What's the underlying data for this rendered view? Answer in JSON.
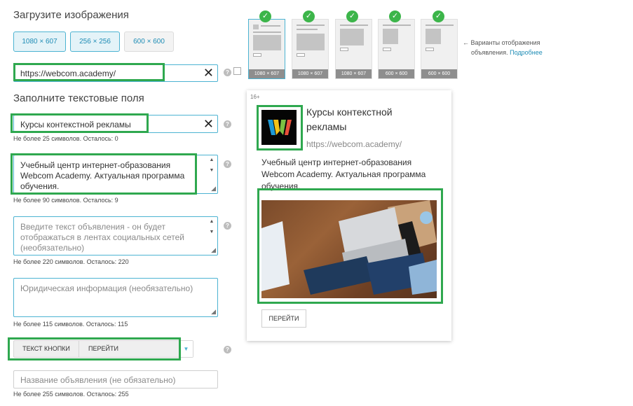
{
  "upload": {
    "heading": "Загрузите изображения",
    "sizes": [
      "1080 × 607",
      "256 × 256",
      "600 × 600"
    ]
  },
  "url_field": {
    "value": "https://webcom.academy/"
  },
  "text_fields_heading": "Заполните текстовые поля",
  "title_field": {
    "value": "Курсы контекстной рекламы",
    "hint": "Не более 25 символов. Осталось: 0"
  },
  "text_field": {
    "lines": [
      "Учебный центр интернет-образования",
      "Webcom Academy. Актуальная программа",
      "обучения."
    ],
    "hint": "Не более 90 символов. Осталось: 9"
  },
  "long_text_field": {
    "placeholder_lines": [
      "Введите текст объявления - он будет",
      "отображаться в лентах социальных сетей",
      "(необязательно)"
    ],
    "hint": "Не более 220 символов. Осталось: 220"
  },
  "legal_field": {
    "placeholder": "Юридическая информация (необязательно)",
    "hint": "Не более 115 символов. Осталось: 115"
  },
  "button_field": {
    "label": "ТЕКСТ КНОПКИ",
    "value": "ПЕРЕЙТИ"
  },
  "name_field": {
    "placeholder": "Название объявления (не обязательно)",
    "hint": "Не более 255 символов. Осталось: 255"
  },
  "variants": {
    "captions": [
      "1080 × 607",
      "1080 × 607",
      "1080 × 607",
      "600 × 600",
      "600 × 600"
    ],
    "note_line1": "← Варианты отображения",
    "note_line2": "объявления.",
    "more_link": "Подробнее"
  },
  "preview": {
    "age": "16+",
    "title_line1": "Курсы контекстной",
    "title_line2": "рекламы",
    "url": "https://webcom.academy/",
    "body_lines": [
      "Учебный центр интернет-образования",
      "Webcom Academy. Актуальная программа",
      "обучения."
    ],
    "button": "ПЕРЕЙТИ"
  },
  "colors": {
    "accent": "#4cb3d2",
    "highlight": "#2fa84f",
    "check": "#3cb54a"
  }
}
